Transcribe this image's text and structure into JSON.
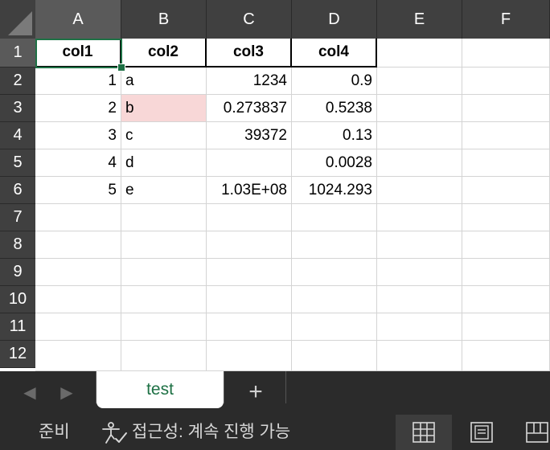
{
  "columns": [
    "A",
    "B",
    "C",
    "D",
    "E",
    "F"
  ],
  "rows": [
    "1",
    "2",
    "3",
    "4",
    "5",
    "6",
    "7",
    "8",
    "9",
    "10",
    "11",
    "12"
  ],
  "cells": {
    "r1": [
      "col1",
      "col2",
      "col3",
      "col4"
    ],
    "r2": [
      "1",
      "a",
      "1234",
      "0.9"
    ],
    "r3": [
      "2",
      "b",
      "0.273837",
      "0.5238"
    ],
    "r4": [
      "3",
      "c",
      "39372",
      "0.13"
    ],
    "r5": [
      "4",
      "d",
      "",
      "0.0028"
    ],
    "r6": [
      "5",
      "e",
      "1.03E+08",
      "1024.293"
    ]
  },
  "selected_cell": "A1",
  "highlight_cell": "B3",
  "colors": {
    "grid_bg": "#ffffff",
    "header_bg": "#404040",
    "header_selected_bg": "#5a5a5a",
    "selection": "#1e7145",
    "highlight": "#f8d7d7",
    "chrome_bg": "#2b2b2b"
  },
  "sheet_tabs": {
    "active": "test",
    "add_label": "+"
  },
  "nav_icons": {
    "prev": "chevron-left-icon",
    "next": "chevron-right-icon"
  },
  "status": {
    "ready": "준비",
    "accessibility": "접근성: 계속 진행 가능",
    "accessibility_icon": "accessibility-check-icon"
  },
  "view_buttons": [
    {
      "name": "normal-view-icon",
      "active": true
    },
    {
      "name": "page-layout-view-icon",
      "active": false
    },
    {
      "name": "page-break-preview-icon",
      "active": false
    }
  ]
}
